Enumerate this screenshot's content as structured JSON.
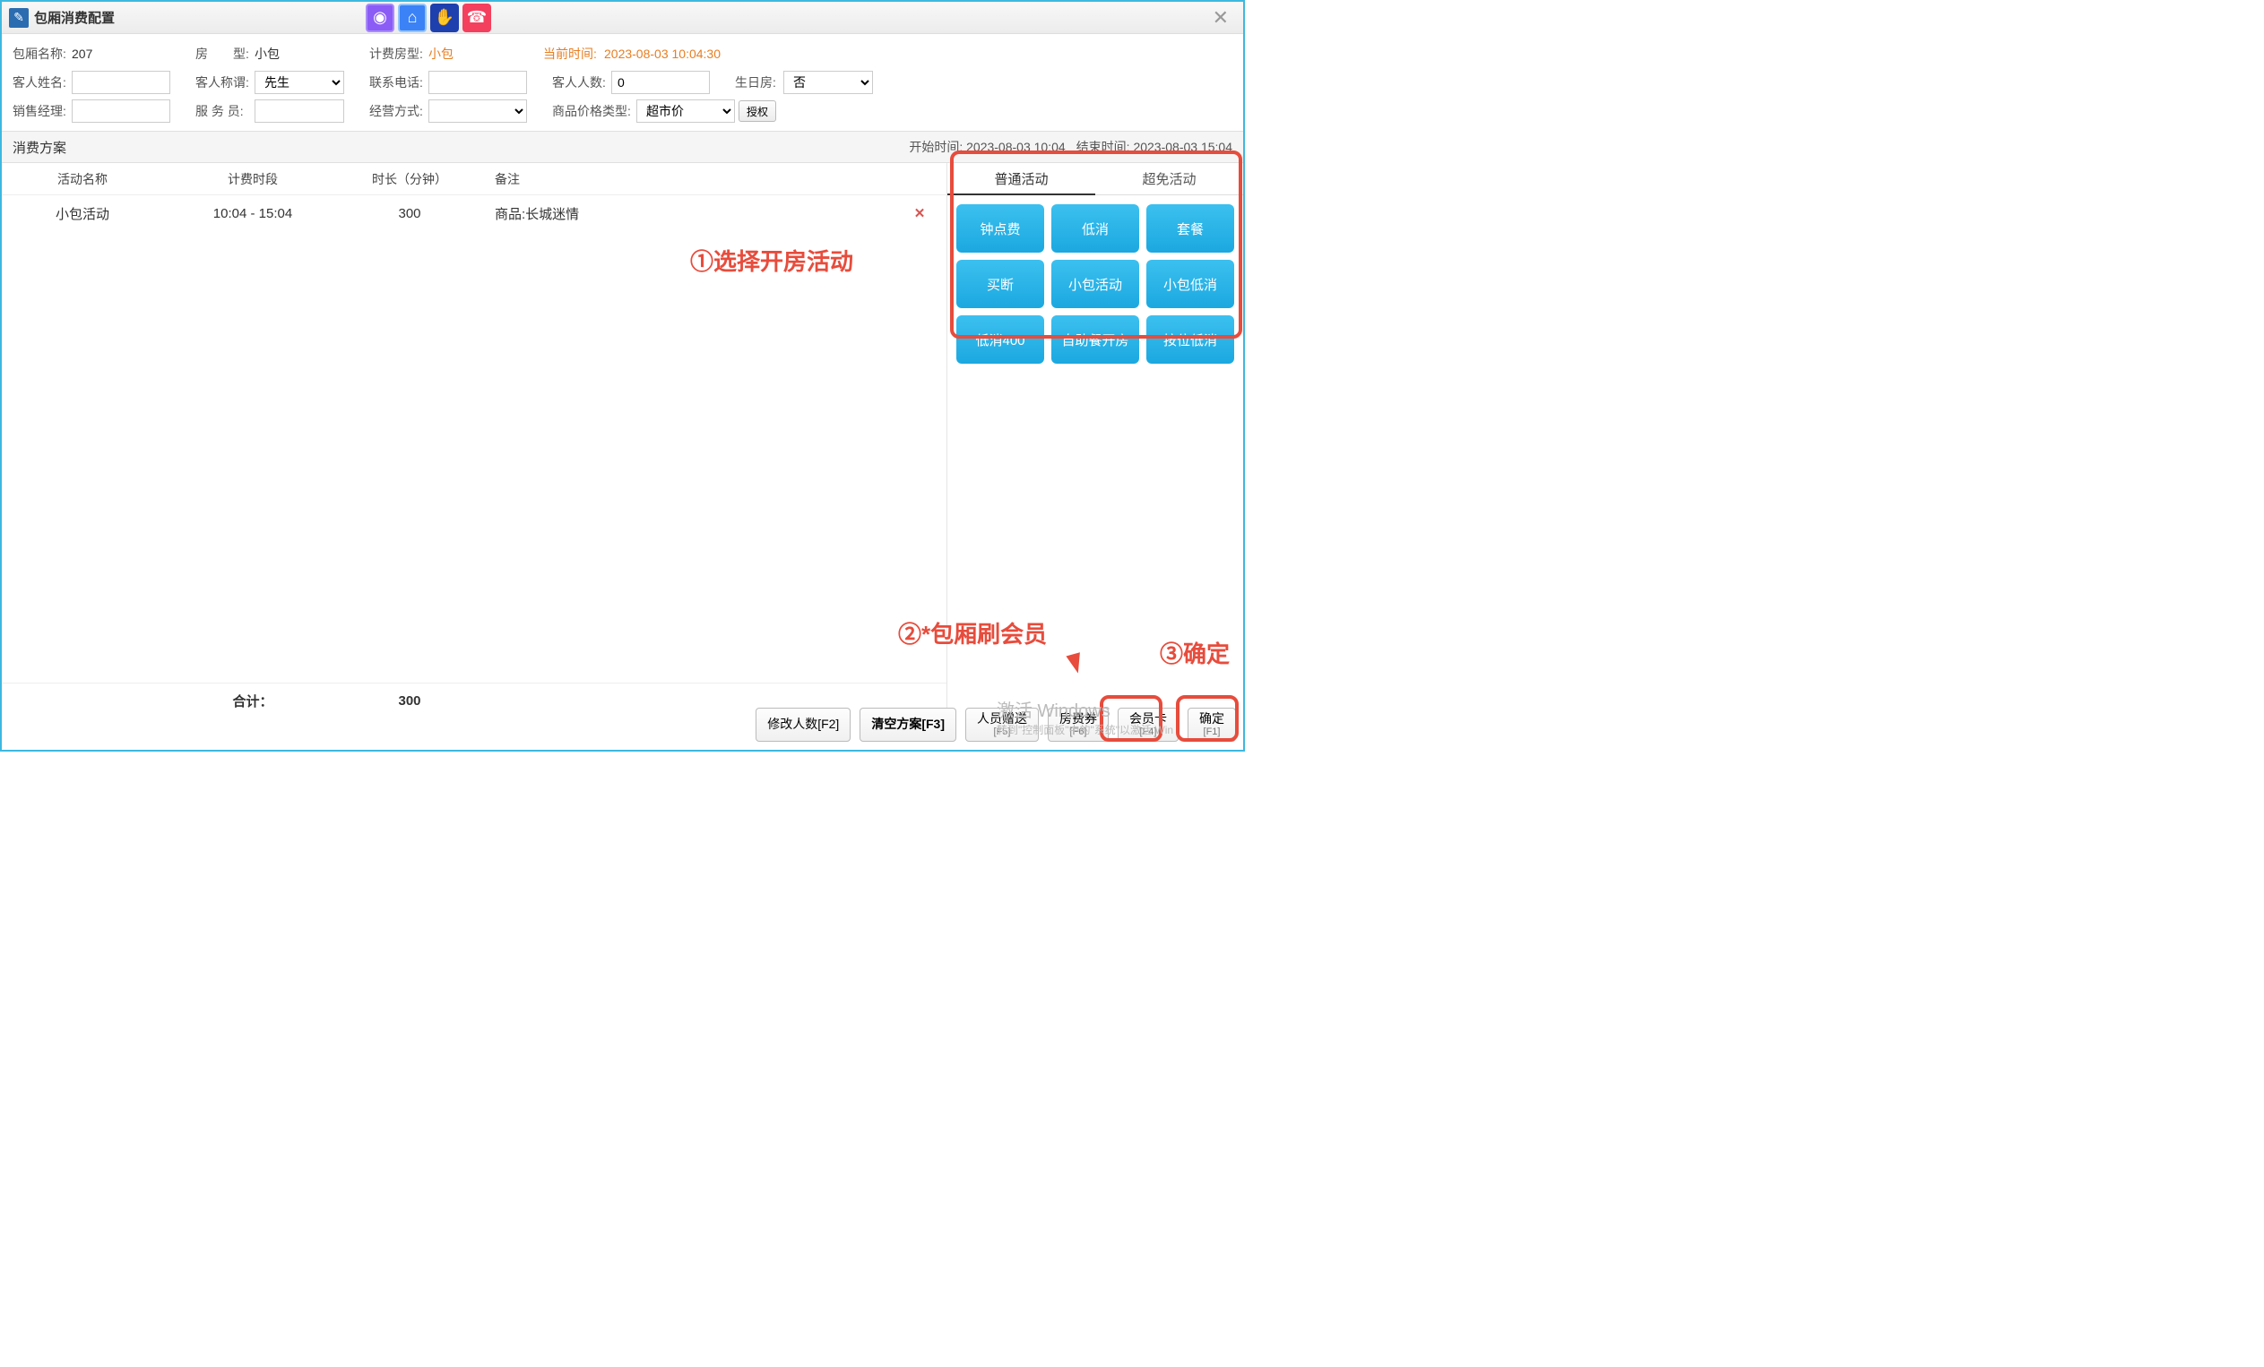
{
  "window": {
    "title": "包厢消费配置"
  },
  "form": {
    "room_name_lbl": "包厢名称:",
    "room_name_val": "207",
    "room_type_lbl": "房　　型:",
    "room_type_val": "小包",
    "billing_type_lbl": "计费房型:",
    "billing_type_val": "小包",
    "current_time_lbl": "当前时间:",
    "current_time_val": "2023-08-03 10:04:30",
    "guest_name_lbl": "客人姓名:",
    "guest_name_val": "",
    "guest_title_lbl": "客人称谓:",
    "guest_title_val": "先生",
    "phone_lbl": "联系电话:",
    "phone_val": "",
    "guest_count_lbl": "客人人数:",
    "guest_count_val": "0",
    "birthday_lbl": "生日房:",
    "birthday_val": "否",
    "sales_mgr_lbl": "销售经理:",
    "sales_mgr_val": "",
    "waiter_lbl": "服 务 员:",
    "waiter_val": "",
    "biz_mode_lbl": "经营方式:",
    "biz_mode_val": "",
    "price_type_lbl": "商品价格类型:",
    "price_type_val": "超市价",
    "auth_btn": "授权"
  },
  "section": {
    "title": "消费方案",
    "start_lbl": "开始时间:",
    "start_val": "2023-08-03 10:04",
    "end_lbl": "结束时间:",
    "end_val": "2023-08-03 15:04"
  },
  "table": {
    "hdr_name": "活动名称",
    "hdr_period": "计费时段",
    "hdr_duration": "时长（分钟）",
    "hdr_remark": "备注",
    "rows": [
      {
        "name": "小包活动",
        "period": "10:04 - 15:04",
        "duration": "300",
        "remark": "商品:长城迷情"
      }
    ],
    "total_lbl": "合计：",
    "total_duration": "300"
  },
  "tabs": {
    "normal": "普通活动",
    "super": "超免活动"
  },
  "activities": [
    "钟点费",
    "低消",
    "套餐",
    "买断",
    "小包活动",
    "小包低消",
    "低消400",
    "自助餐开房",
    "按位低消"
  ],
  "footer": {
    "modify_count": "修改人数[F2]",
    "clear_plan": "清空方案[F3]",
    "gift": "人员赠送",
    "gift_k": "[F5]",
    "coupon": "房费券",
    "coupon_k": "[F6]",
    "member": "会员卡",
    "member_k": "[F4]",
    "confirm": "确定",
    "confirm_k": "[F1]"
  },
  "annotations": {
    "step1": "①选择开房活动",
    "step2": "②*包厢刷会员",
    "step3": "③确定"
  },
  "watermark": {
    "line1": "激活 Windows",
    "line2": "转到\"控制面板\"中的\"系统\"以激活 Win"
  }
}
